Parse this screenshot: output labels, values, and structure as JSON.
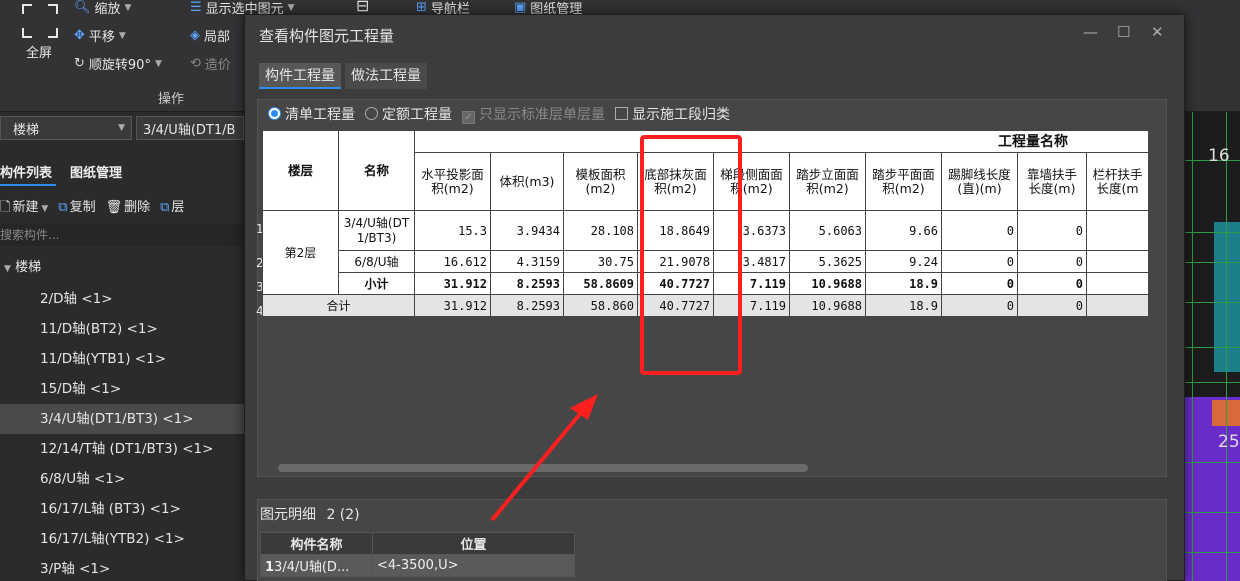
{
  "ribbon": {
    "fullscreen": "全屏",
    "zoom": "缩放",
    "pan": "平移",
    "rotate": "顺旋转90°",
    "show_selected": "显示选中图元",
    "partial": "局部",
    "cost": "造价",
    "navbar": "导航栏",
    "drawing_mgmt": "图纸管理",
    "group": "操作"
  },
  "left_panel": {
    "floor_combo": "楼梯",
    "member_combo": "3/4/U轴(DT1/B",
    "tabs": [
      "构件列表",
      "图纸管理"
    ],
    "tools": {
      "new": "新建",
      "copy": "复制",
      "delete": "删除",
      "layer": "层"
    },
    "search_placeholder": "搜索构件...",
    "tree_root": "楼梯",
    "tree_items": [
      "2/D轴 <1>",
      "11/D轴(BT2) <1>",
      "11/D轴(YTB1) <1>",
      "15/D轴 <1>",
      "3/4/U轴(DT1/BT3) <1>",
      "12/14/T轴 (DT1/BT3)  <1>",
      "6/8/U轴 <1>",
      "16/17/L轴 (BT3)  <1>",
      "16/17/L轴(YTB2)  <1>",
      "3/P轴 <1>"
    ],
    "selected_index": 4
  },
  "drawing": {
    "label_top": "16",
    "label_mid": "25"
  },
  "dialog": {
    "title": "查看构件图元工程量",
    "tabs": [
      "构件工程量",
      "做法工程量"
    ],
    "options": {
      "bill": "清单工程量",
      "quota": "定额工程量",
      "std_floor": "只显示标准层单层量",
      "construction": "显示施工段归类"
    },
    "table": {
      "group_header": "工程量名称",
      "col_floor": "楼层",
      "col_name": "名称",
      "columns": [
        "水平投影面积(m2)",
        "体积(m3)",
        "模板面积(m2)",
        "底部抹灰面积(m2)",
        "梯段侧面面积(m2)",
        "踏步立面面积(m2)",
        "踏步平面面积(m2)",
        "踢脚线长度(直)(m)",
        "靠墙扶手长度(m)",
        "栏杆扶手长度(m"
      ],
      "floor_label": "第2层",
      "rows": [
        {
          "no": "1",
          "name": "3/4/U轴(DT1/BT3)",
          "values": [
            "15.3",
            "3.9434",
            "28.108",
            "18.8649",
            "3.6373",
            "5.6063",
            "9.66",
            "0",
            "0",
            ""
          ]
        },
        {
          "no": "2",
          "name": "6/8/U轴",
          "values": [
            "16.612",
            "4.3159",
            "30.75",
            "21.9078",
            "3.4817",
            "5.3625",
            "9.24",
            "0",
            "0",
            ""
          ]
        },
        {
          "no": "3",
          "name": "小计",
          "values": [
            "31.912",
            "8.2593",
            "58.8609",
            "40.7727",
            "7.119",
            "10.9688",
            "18.9",
            "0",
            "0",
            ""
          ]
        },
        {
          "no": "4",
          "name": "合计",
          "values": [
            "31.912",
            "8.2593",
            "58.860",
            "40.7727",
            "7.119",
            "10.9688",
            "18.9",
            "0",
            "0",
            ""
          ]
        }
      ]
    },
    "detail": {
      "title": "图元明细",
      "count": "2 (2)",
      "headers": [
        "构件名称",
        "位置"
      ],
      "row": {
        "no": "1",
        "name": "3/4/U轴(D...",
        "position": "<4-3500,U>"
      }
    }
  },
  "colors": {
    "highlight": "#ff1f1f",
    "accent": "#2d8cf0"
  }
}
